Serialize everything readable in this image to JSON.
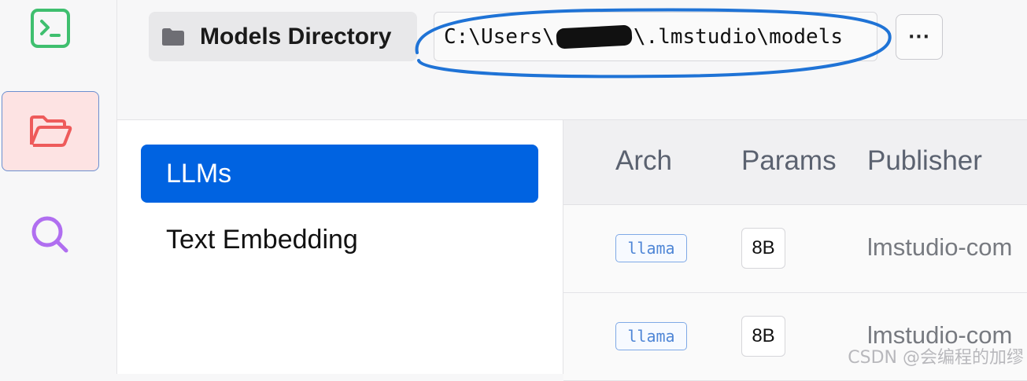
{
  "rail": {
    "items": [
      {
        "icon": "terminal-icon",
        "color": "#3fbf6f"
      },
      {
        "icon": "folder-open-icon",
        "color": "#ee5b5b",
        "active": true
      },
      {
        "icon": "search-icon",
        "color": "#b06ef0"
      }
    ]
  },
  "header": {
    "directory_label": "Models Directory",
    "path_prefix": "C:\\Users\\",
    "path_suffix": "\\.lmstudio\\models",
    "more_label": "···"
  },
  "categories": [
    {
      "label": "LLMs",
      "active": true
    },
    {
      "label": "Text Embedding",
      "active": false
    }
  ],
  "table": {
    "columns": [
      "Arch",
      "Params",
      "Publisher"
    ],
    "rows": [
      {
        "arch": "llama",
        "params": "8B",
        "publisher": "lmstudio-com"
      },
      {
        "arch": "llama",
        "params": "8B",
        "publisher": "lmstudio-com"
      }
    ]
  },
  "watermark": "CSDN @会编程的加缪",
  "colors": {
    "accent": "#0063e1",
    "highlight_ring": "#1f73d6"
  }
}
